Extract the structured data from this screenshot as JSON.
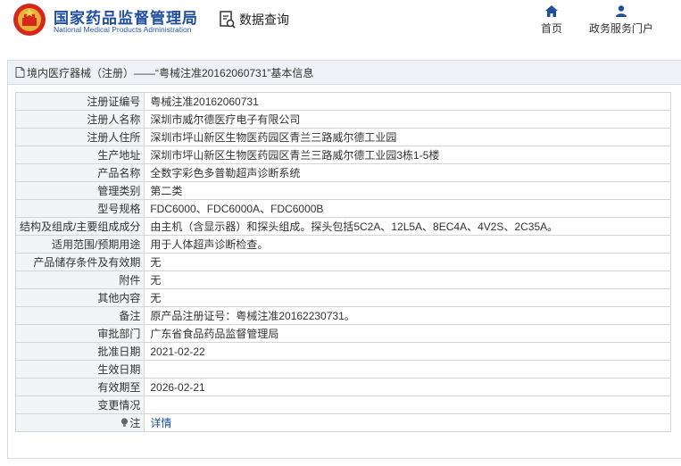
{
  "header": {
    "site_title": "国家药品监督管理局",
    "site_subtitle": "National Medical Products Administration",
    "query_label": "数据查询",
    "nav": [
      {
        "label": "首页",
        "icon": "home-icon"
      },
      {
        "label": "政务服务门户",
        "icon": "user-icon"
      }
    ]
  },
  "panel": {
    "breadcrumb": "境内医疗器械（注册）——“粤械注准20162060731”基本信息"
  },
  "records": [
    {
      "key": "注册证编号",
      "value": "粤械注准20162060731"
    },
    {
      "key": "注册人名称",
      "value": "深圳市威尔德医疗电子有限公司"
    },
    {
      "key": "注册人住所",
      "value": "深圳市坪山新区生物医药园区青兰三路威尔德工业园"
    },
    {
      "key": "生产地址",
      "value": "深圳市坪山新区生物医药园区青兰三路威尔德工业园3栋1-5楼"
    },
    {
      "key": "产品名称",
      "value": "全数字彩色多普勒超声诊断系统"
    },
    {
      "key": "管理类别",
      "value": "第二类"
    },
    {
      "key": "型号规格",
      "value": "FDC6000、FDC6000A、FDC6000B"
    },
    {
      "key": "结构及组成/主要组成成分",
      "value": "由主机（含显示器）和探头组成。探头包括5C2A、12L5A、8EC4A、4V2S、2C35A。"
    },
    {
      "key": "适用范围/预期用途",
      "value": "用于人体超声诊断检查。"
    },
    {
      "key": "产品储存条件及有效期",
      "value": "无"
    },
    {
      "key": "附件",
      "value": "无"
    },
    {
      "key": "其他内容",
      "value": "无"
    },
    {
      "key": "备注",
      "value": "原产品注册证号：粤械注准20162230731。"
    },
    {
      "key": "审批部门",
      "value": "广东省食品药品监督管理局"
    },
    {
      "key": "批准日期",
      "value": "2021-02-22"
    },
    {
      "key": "生效日期",
      "value": ""
    },
    {
      "key": "有效期至",
      "value": "2026-02-21"
    },
    {
      "key": "变更情况",
      "value": ""
    }
  ],
  "note_row": {
    "key": "注",
    "value": "详情",
    "icon": "bulb-icon"
  }
}
